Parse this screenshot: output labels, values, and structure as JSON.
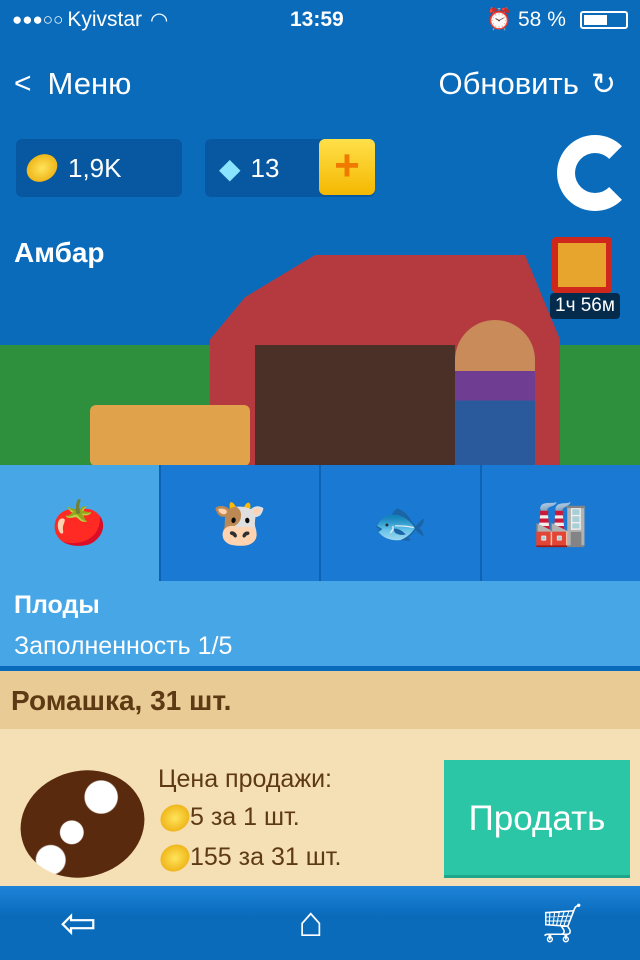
{
  "status": {
    "signal": "●●●○○",
    "carrier": "Kyivstar",
    "time": "13:59",
    "battery": "58 %",
    "battery_level": 0.58
  },
  "nav": {
    "back_label": "Меню",
    "refresh_label": "Обновить"
  },
  "currency": {
    "coins": "1,9K",
    "gems": "13"
  },
  "banner": {
    "title": "Амбар",
    "gift_timer": "1ч 56м"
  },
  "tabs": [
    {
      "icon": "vegetables-icon",
      "selected": true
    },
    {
      "icon": "animal-products-icon",
      "selected": false
    },
    {
      "icon": "fish-icon",
      "selected": false
    },
    {
      "icon": "factory-icon",
      "selected": false
    }
  ],
  "category": {
    "title": "Плоды",
    "fill": "Заполненность 1/5"
  },
  "item": {
    "title": "Ромашка, 31 шт.",
    "price_label": "Цена продажи:",
    "price_one": "5 за 1 шт.",
    "price_all": "155 за 31 шт.",
    "sell_label": "Продать"
  },
  "colors": {
    "primary": "#0a6bbb",
    "sell": "#2bc6a6",
    "tab_selected": "#47a6e5"
  }
}
